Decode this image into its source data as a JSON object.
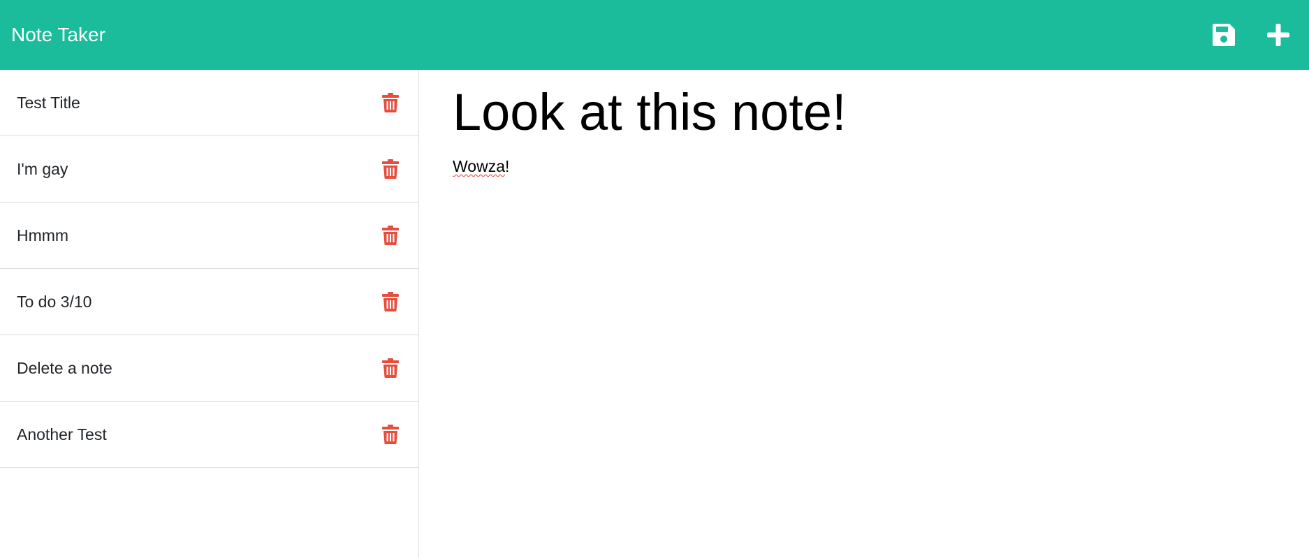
{
  "app": {
    "title": "Note Taker"
  },
  "colors": {
    "navbar": "#1abc9c",
    "delete": "#e74c3c"
  },
  "toolbar": {
    "save_icon": "floppy-disk-icon",
    "new_icon": "plus-icon"
  },
  "notes": [
    {
      "title": "Test Title"
    },
    {
      "title": "I'm gay"
    },
    {
      "title": "Hmmm"
    },
    {
      "title": "To do 3/10"
    },
    {
      "title": "Delete a note"
    },
    {
      "title": "Another Test"
    }
  ],
  "active_note": {
    "title": "Look at this note!",
    "body_word": "Wowza",
    "body_punct": "!"
  }
}
